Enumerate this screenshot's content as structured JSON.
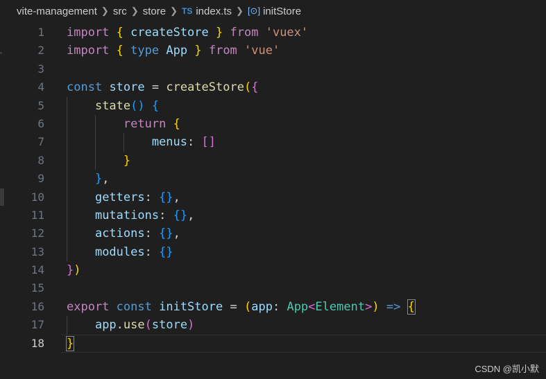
{
  "breadcrumb": {
    "project": "vite-management",
    "folder1": "src",
    "folder2": "store",
    "file_icon": "TS",
    "file": "index.ts",
    "symbol": "initStore"
  },
  "editor": {
    "current_line": "18",
    "lines": [
      {
        "n": "1",
        "tokens": [
          {
            "t": "import",
            "c": "kwc"
          },
          {
            "t": " "
          },
          {
            "t": "{",
            "c": "b1"
          },
          {
            "t": " "
          },
          {
            "t": "createStore",
            "c": "var"
          },
          {
            "t": " "
          },
          {
            "t": "}",
            "c": "b1"
          },
          {
            "t": " "
          },
          {
            "t": "from",
            "c": "kwc"
          },
          {
            "t": " "
          },
          {
            "t": "'vuex'",
            "c": "str"
          }
        ]
      },
      {
        "n": "2",
        "tokens": [
          {
            "t": "import",
            "c": "kwc"
          },
          {
            "t": " "
          },
          {
            "t": "{",
            "c": "b1"
          },
          {
            "t": " "
          },
          {
            "t": "type",
            "c": "kw"
          },
          {
            "t": " "
          },
          {
            "t": "App",
            "c": "var"
          },
          {
            "t": " "
          },
          {
            "t": "}",
            "c": "b1"
          },
          {
            "t": " "
          },
          {
            "t": "from",
            "c": "kwc"
          },
          {
            "t": " "
          },
          {
            "t": "'vue'",
            "c": "str"
          }
        ]
      },
      {
        "n": "3",
        "tokens": []
      },
      {
        "n": "4",
        "tokens": [
          {
            "t": "const",
            "c": "kw"
          },
          {
            "t": " "
          },
          {
            "t": "store",
            "c": "var"
          },
          {
            "t": " "
          },
          {
            "t": "=",
            "c": "plain"
          },
          {
            "t": " "
          },
          {
            "t": "createStore",
            "c": "fn"
          },
          {
            "t": "(",
            "c": "b1"
          },
          {
            "t": "{",
            "c": "b2"
          }
        ]
      },
      {
        "n": "5",
        "tokens": [
          {
            "t": "    "
          },
          {
            "t": "state",
            "c": "fn"
          },
          {
            "t": "()",
            "c": "b3"
          },
          {
            "t": " "
          },
          {
            "t": "{",
            "c": "b3"
          }
        ]
      },
      {
        "n": "6",
        "tokens": [
          {
            "t": "        "
          },
          {
            "t": "return",
            "c": "kwc"
          },
          {
            "t": " "
          },
          {
            "t": "{",
            "c": "b1"
          }
        ]
      },
      {
        "n": "7",
        "tokens": [
          {
            "t": "            "
          },
          {
            "t": "menus",
            "c": "var"
          },
          {
            "t": ":",
            "c": "plain"
          },
          {
            "t": " "
          },
          {
            "t": "[]",
            "c": "b2"
          }
        ]
      },
      {
        "n": "8",
        "tokens": [
          {
            "t": "        "
          },
          {
            "t": "}",
            "c": "b1"
          }
        ]
      },
      {
        "n": "9",
        "tokens": [
          {
            "t": "    "
          },
          {
            "t": "}",
            "c": "b3"
          },
          {
            "t": ",",
            "c": "plain"
          }
        ]
      },
      {
        "n": "10",
        "tokens": [
          {
            "t": "    "
          },
          {
            "t": "getters",
            "c": "var"
          },
          {
            "t": ":",
            "c": "plain"
          },
          {
            "t": " "
          },
          {
            "t": "{}",
            "c": "b3"
          },
          {
            "t": ",",
            "c": "plain"
          }
        ]
      },
      {
        "n": "11",
        "tokens": [
          {
            "t": "    "
          },
          {
            "t": "mutations",
            "c": "var"
          },
          {
            "t": ":",
            "c": "plain"
          },
          {
            "t": " "
          },
          {
            "t": "{}",
            "c": "b3"
          },
          {
            "t": ",",
            "c": "plain"
          }
        ]
      },
      {
        "n": "12",
        "tokens": [
          {
            "t": "    "
          },
          {
            "t": "actions",
            "c": "var"
          },
          {
            "t": ":",
            "c": "plain"
          },
          {
            "t": " "
          },
          {
            "t": "{}",
            "c": "b3"
          },
          {
            "t": ",",
            "c": "plain"
          }
        ]
      },
      {
        "n": "13",
        "tokens": [
          {
            "t": "    "
          },
          {
            "t": "modules",
            "c": "var"
          },
          {
            "t": ":",
            "c": "plain"
          },
          {
            "t": " "
          },
          {
            "t": "{}",
            "c": "b3"
          }
        ]
      },
      {
        "n": "14",
        "tokens": [
          {
            "t": "}",
            "c": "b2"
          },
          {
            "t": ")",
            "c": "b1"
          }
        ]
      },
      {
        "n": "15",
        "tokens": []
      },
      {
        "n": "16",
        "tokens": [
          {
            "t": "export",
            "c": "kwc"
          },
          {
            "t": " "
          },
          {
            "t": "const",
            "c": "kw"
          },
          {
            "t": " "
          },
          {
            "t": "initStore",
            "c": "var"
          },
          {
            "t": " "
          },
          {
            "t": "=",
            "c": "plain"
          },
          {
            "t": " "
          },
          {
            "t": "(",
            "c": "b1"
          },
          {
            "t": "app",
            "c": "var"
          },
          {
            "t": ":",
            "c": "plain"
          },
          {
            "t": " "
          },
          {
            "t": "App",
            "c": "type"
          },
          {
            "t": "<",
            "c": "b2"
          },
          {
            "t": "Element",
            "c": "type"
          },
          {
            "t": ">",
            "c": "b2"
          },
          {
            "t": ")",
            "c": "b1"
          },
          {
            "t": " "
          },
          {
            "t": "=>",
            "c": "kw"
          },
          {
            "t": " "
          },
          {
            "t": "{",
            "c": "b1 match"
          }
        ]
      },
      {
        "n": "17",
        "tokens": [
          {
            "t": "    "
          },
          {
            "t": "app",
            "c": "var"
          },
          {
            "t": ".",
            "c": "plain"
          },
          {
            "t": "use",
            "c": "fn"
          },
          {
            "t": "(",
            "c": "b2"
          },
          {
            "t": "store",
            "c": "var"
          },
          {
            "t": ")",
            "c": "b2"
          }
        ]
      },
      {
        "n": "18",
        "tokens": [
          {
            "t": "}",
            "c": "b1 match"
          }
        ]
      }
    ]
  },
  "watermark": "CSDN @凯小默"
}
